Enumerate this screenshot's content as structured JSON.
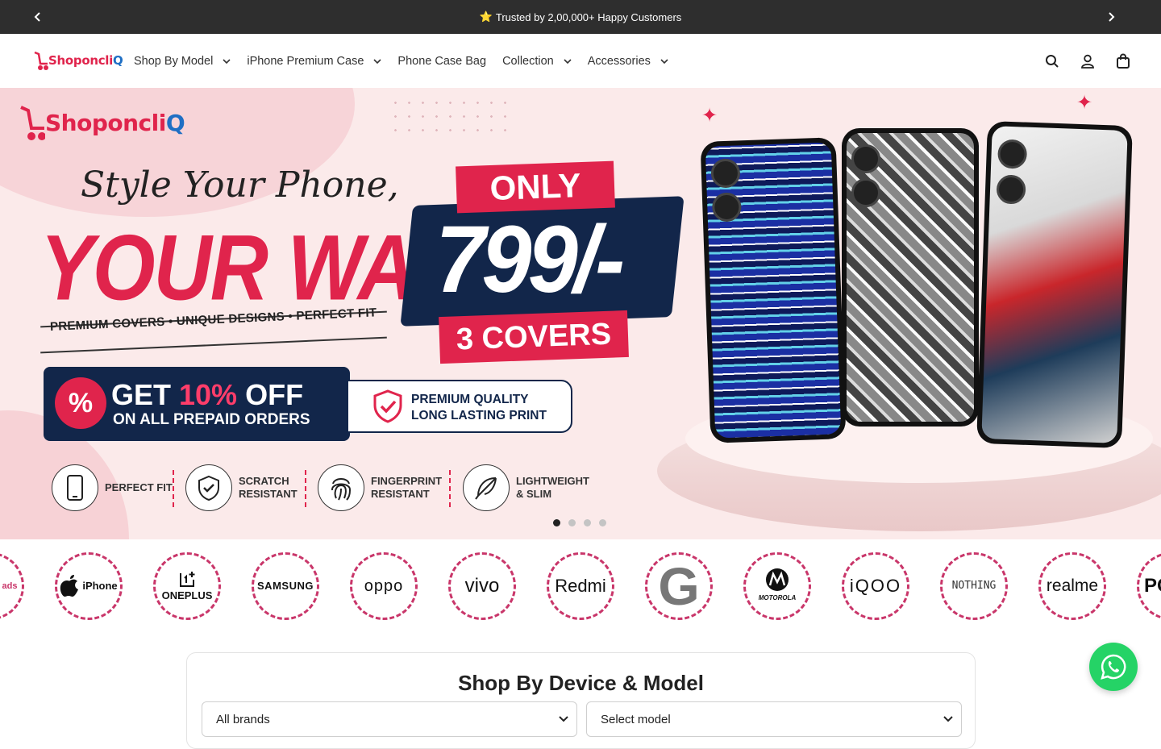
{
  "announcement": {
    "text": "Trusted by 2,00,000+ Happy Customers",
    "star": "⭐"
  },
  "brand": {
    "name_part1": "Shop",
    "name_part2": "oncli",
    "name_part3": "Q",
    "accent": "#e0244c",
    "secondary": "#1f6fc4"
  },
  "nav": [
    {
      "label": "Shop By Model",
      "has_dropdown": true
    },
    {
      "label": "iPhone Premium Case",
      "has_dropdown": true
    },
    {
      "label": "Phone Case Bag",
      "has_dropdown": false
    },
    {
      "label": "Collection",
      "has_dropdown": true
    },
    {
      "label": "Accessories",
      "has_dropdown": true
    }
  ],
  "header_icons": [
    "search-icon",
    "account-icon",
    "cart-icon"
  ],
  "hero": {
    "script_line": "Style Your Phone,",
    "headline": "YOUR WAY!",
    "tagline": "PREMIUM COVERS • UNIQUE DESIGNS • PERFECT FIT",
    "only": "ONLY",
    "price": "799/-",
    "covers": "3 COVERS",
    "offer_pct": "%",
    "offer_get": "GET ",
    "offer_value": "10%",
    "offer_off": " OFF",
    "offer_sub": "ON ALL PREPAID ORDERS",
    "quality_line1": "PREMIUM QUALITY",
    "quality_line2": "LONG LASTING PRINT",
    "features": [
      {
        "line1": "PERFECT FIT",
        "line2": "",
        "icon": "phone-icon"
      },
      {
        "line1": "SCRATCH",
        "line2": "RESISTANT",
        "icon": "shield-check-icon"
      },
      {
        "line1": "FINGERPRINT",
        "line2": "RESISTANT",
        "icon": "fingerprint-icon"
      },
      {
        "line1": "LIGHTWEIGHT",
        "line2": "& SLIM",
        "icon": "feather-icon"
      }
    ],
    "slides_total": 4,
    "active_slide": 1
  },
  "brands": [
    {
      "label": "ads"
    },
    {
      "label": "iPhone"
    },
    {
      "label": "ONEPLUS"
    },
    {
      "label": "SAMSUNG"
    },
    {
      "label": "oppo"
    },
    {
      "label": "vivo"
    },
    {
      "label": "Redmi"
    },
    {
      "label": "G"
    },
    {
      "label": "MOTOROLA"
    },
    {
      "label": "iQOO"
    },
    {
      "label": "NOTHING"
    },
    {
      "label": "realme"
    },
    {
      "label": "PO"
    }
  ],
  "device_section": {
    "title": "Shop By Device & Model",
    "brand_select": "All brands",
    "model_select": "Select model"
  }
}
